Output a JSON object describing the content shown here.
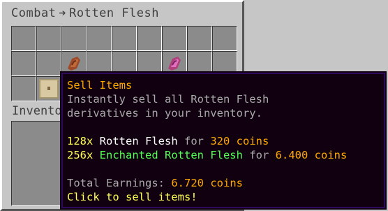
{
  "window": {
    "title_left": "Combat",
    "title_arrow": "➔",
    "title_right": "Rotten Flesh",
    "inventory_label": "Inventory"
  },
  "grid": {
    "rows": 3,
    "cols": 9,
    "items": [
      {
        "row": 1,
        "col": 2,
        "icon": "rotten-flesh-icon"
      },
      {
        "row": 1,
        "col": 6,
        "icon": "enchanted-rotten-flesh-icon"
      },
      {
        "row": 2,
        "col": 1,
        "icon": "chest-icon"
      }
    ]
  },
  "tooltip": {
    "title": "Sell Items",
    "desc_line1": "Instantly sell all Rotten Flesh",
    "desc_line2": "derivatives in your inventory.",
    "row1": {
      "count": "128x",
      "name": "Rotten Flesh",
      "for": "for",
      "price": "320 coins"
    },
    "row2": {
      "count": "256x",
      "name": "Enchanted Rotten Flesh",
      "for": "for",
      "price": "6.400 coins"
    },
    "total_label": "Total Earnings:",
    "total_value": "6.720 coins",
    "action": "Click to sell items!"
  },
  "colors": {
    "gold": "#ffaa00",
    "yellow": "#ffff55",
    "green": "#55ff55",
    "gray": "#aaaaaa",
    "tooltip_bg": "#100010",
    "tooltip_border": "#2d0a5b"
  }
}
